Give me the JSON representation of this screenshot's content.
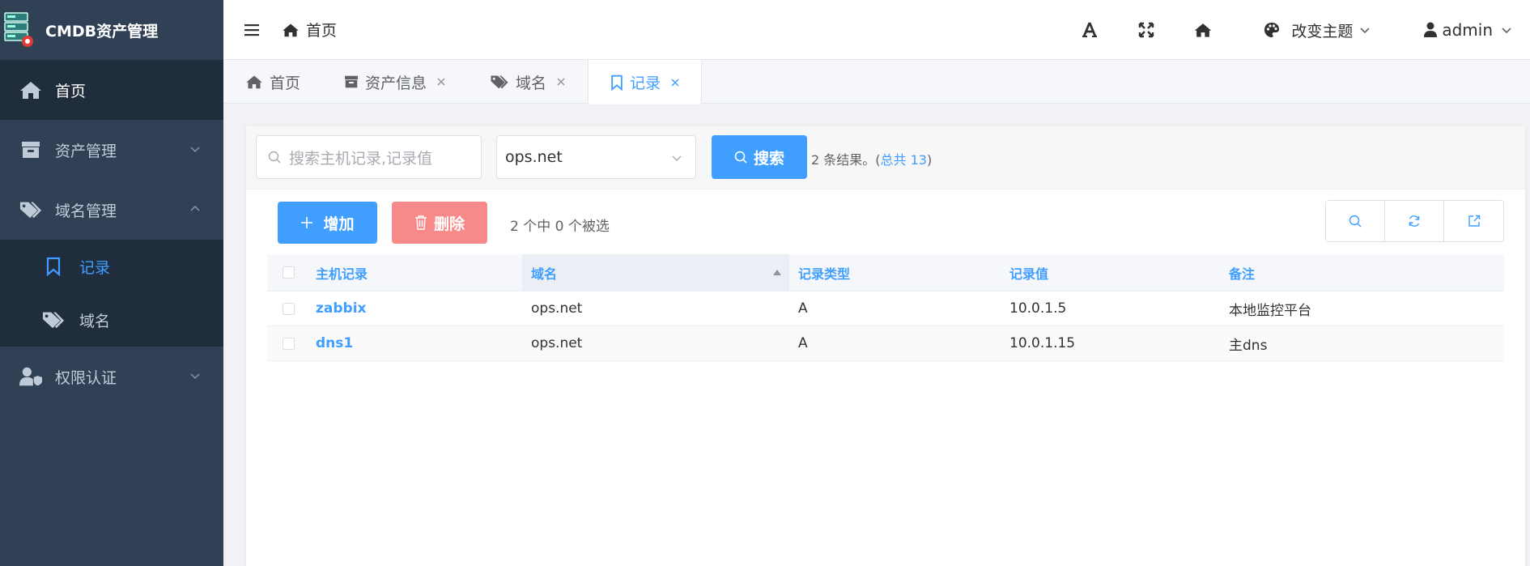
{
  "app": {
    "title": "CMDB资产管理"
  },
  "sidebar": {
    "items": [
      {
        "label": "首页",
        "icon": "home-icon"
      },
      {
        "label": "资产管理",
        "icon": "archive-icon"
      },
      {
        "label": "域名管理",
        "icon": "tags-icon",
        "expanded": true,
        "children": [
          {
            "label": "记录",
            "icon": "bookmark-icon",
            "active": true
          },
          {
            "label": "域名",
            "icon": "tags-icon"
          }
        ]
      },
      {
        "label": "权限认证",
        "icon": "user-shield-icon"
      }
    ]
  },
  "header": {
    "breadcrumb": "首页",
    "theme_label": "改变主题",
    "user_label": "admin"
  },
  "tabs": [
    {
      "label": "首页",
      "closable": false
    },
    {
      "label": "资产信息",
      "closable": true
    },
    {
      "label": "域名",
      "closable": true
    },
    {
      "label": "记录",
      "closable": true,
      "active": true
    }
  ],
  "search": {
    "placeholder": "搜索主机记录,记录值",
    "select_value": "ops.net",
    "button_label": "搜索",
    "result_prefix": "2 条结果。(",
    "result_total": "总共 13",
    "result_suffix": ")"
  },
  "toolbar": {
    "add_label": "增加",
    "delete_label": "删除",
    "selection_text": "2 个中 0 个被选"
  },
  "table": {
    "columns": [
      "主机记录",
      "域名",
      "记录类型",
      "记录值",
      "备注"
    ],
    "rows": [
      {
        "host": "zabbix",
        "domain": "ops.net",
        "type": "A",
        "value": "10.0.1.5",
        "note": "本地监控平台"
      },
      {
        "host": "dns1",
        "domain": "ops.net",
        "type": "A",
        "value": "10.0.1.15",
        "note": "主dns"
      }
    ]
  },
  "colors": {
    "sidebar_bg": "#304156",
    "sidebar_active_bg": "#1f2d3d",
    "primary": "#409eff",
    "danger": "#f78989"
  }
}
